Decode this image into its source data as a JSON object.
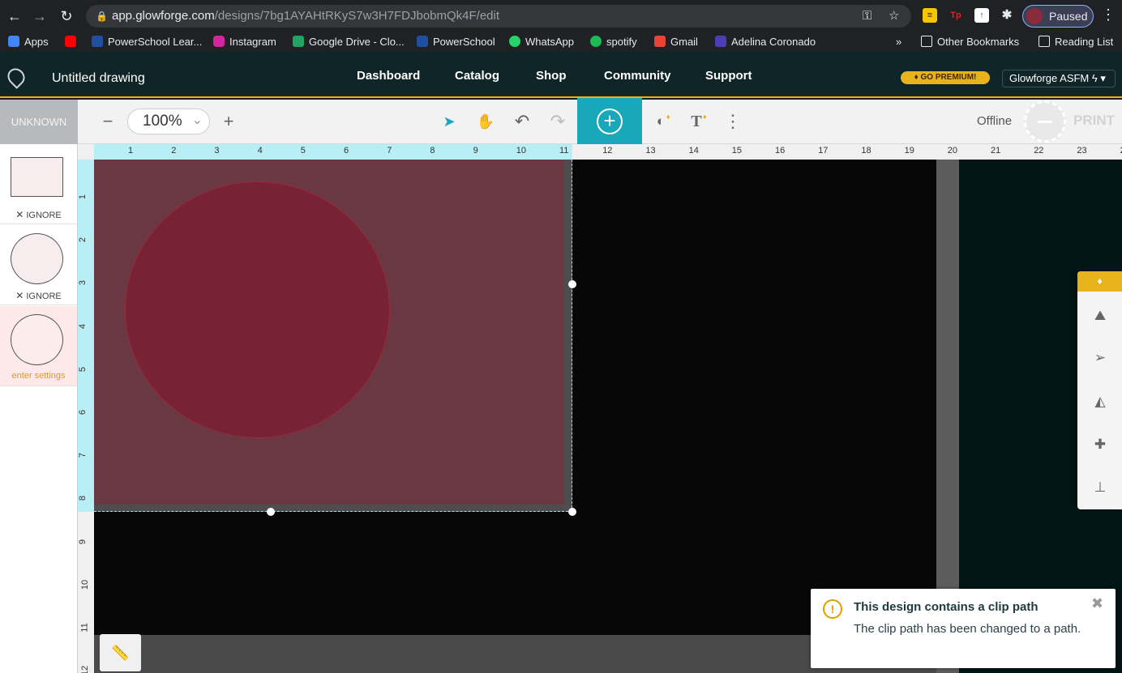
{
  "browser": {
    "url_host": "app.glowforge.com",
    "url_path": "/designs/7bg1AYAHtRKyS7w3H7FDJbobmQk4F/edit",
    "profile_label": "Paused"
  },
  "bookmarks": [
    {
      "label": "Apps",
      "color": "#4285f4"
    },
    {
      "label": "PowerSchool Lear...",
      "color": "#1e50a0"
    },
    {
      "label": "Instagram",
      "color": "#d6249f"
    },
    {
      "label": "Google Drive - Clo...",
      "color": "#1fa463"
    },
    {
      "label": "PowerSchool",
      "color": "#1e50a0"
    },
    {
      "label": "WhatsApp",
      "color": "#25d366"
    },
    {
      "label": "spotify",
      "color": "#1db954"
    },
    {
      "label": "Gmail",
      "color": "#ea4335"
    },
    {
      "label": "Adelina Coronado",
      "color": "#4a3fb5"
    }
  ],
  "bookmarks_right": {
    "overflow": "»",
    "other": "Other Bookmarks",
    "reading": "Reading List"
  },
  "header": {
    "title": "Untitled drawing",
    "nav": [
      "Dashboard",
      "Catalog",
      "Shop",
      "Community",
      "Support"
    ],
    "premium": "GO PREMIUM!",
    "account": "Glowforge ASFM"
  },
  "toolbar": {
    "material": "UNKNOWN",
    "zoom": "100%",
    "status": "Offline",
    "print": "PRINT"
  },
  "operations": [
    {
      "label": "IGNORE",
      "shape": "square",
      "state": "ignore"
    },
    {
      "label": "IGNORE",
      "shape": "circle",
      "state": "ignore"
    },
    {
      "label": "enter settings",
      "shape": "circle",
      "state": "active"
    }
  ],
  "ruler": {
    "top": [
      "1",
      "2",
      "3",
      "4",
      "5",
      "6",
      "7",
      "8",
      "9",
      "10",
      "11",
      "12",
      "13",
      "14",
      "15",
      "16",
      "17",
      "18",
      "19",
      "20",
      "21",
      "22",
      "23",
      "2"
    ],
    "left": [
      "1",
      "2",
      "3",
      "4",
      "5",
      "6",
      "7",
      "8",
      "9",
      "10",
      "11",
      "12"
    ]
  },
  "toast": {
    "title": "This design contains a clip path",
    "body": "The clip path has been changed to a path."
  },
  "colors": {
    "accent": "#19a7ba",
    "premium": "#e8b21b",
    "material": "#693843",
    "shape": "#782236"
  }
}
